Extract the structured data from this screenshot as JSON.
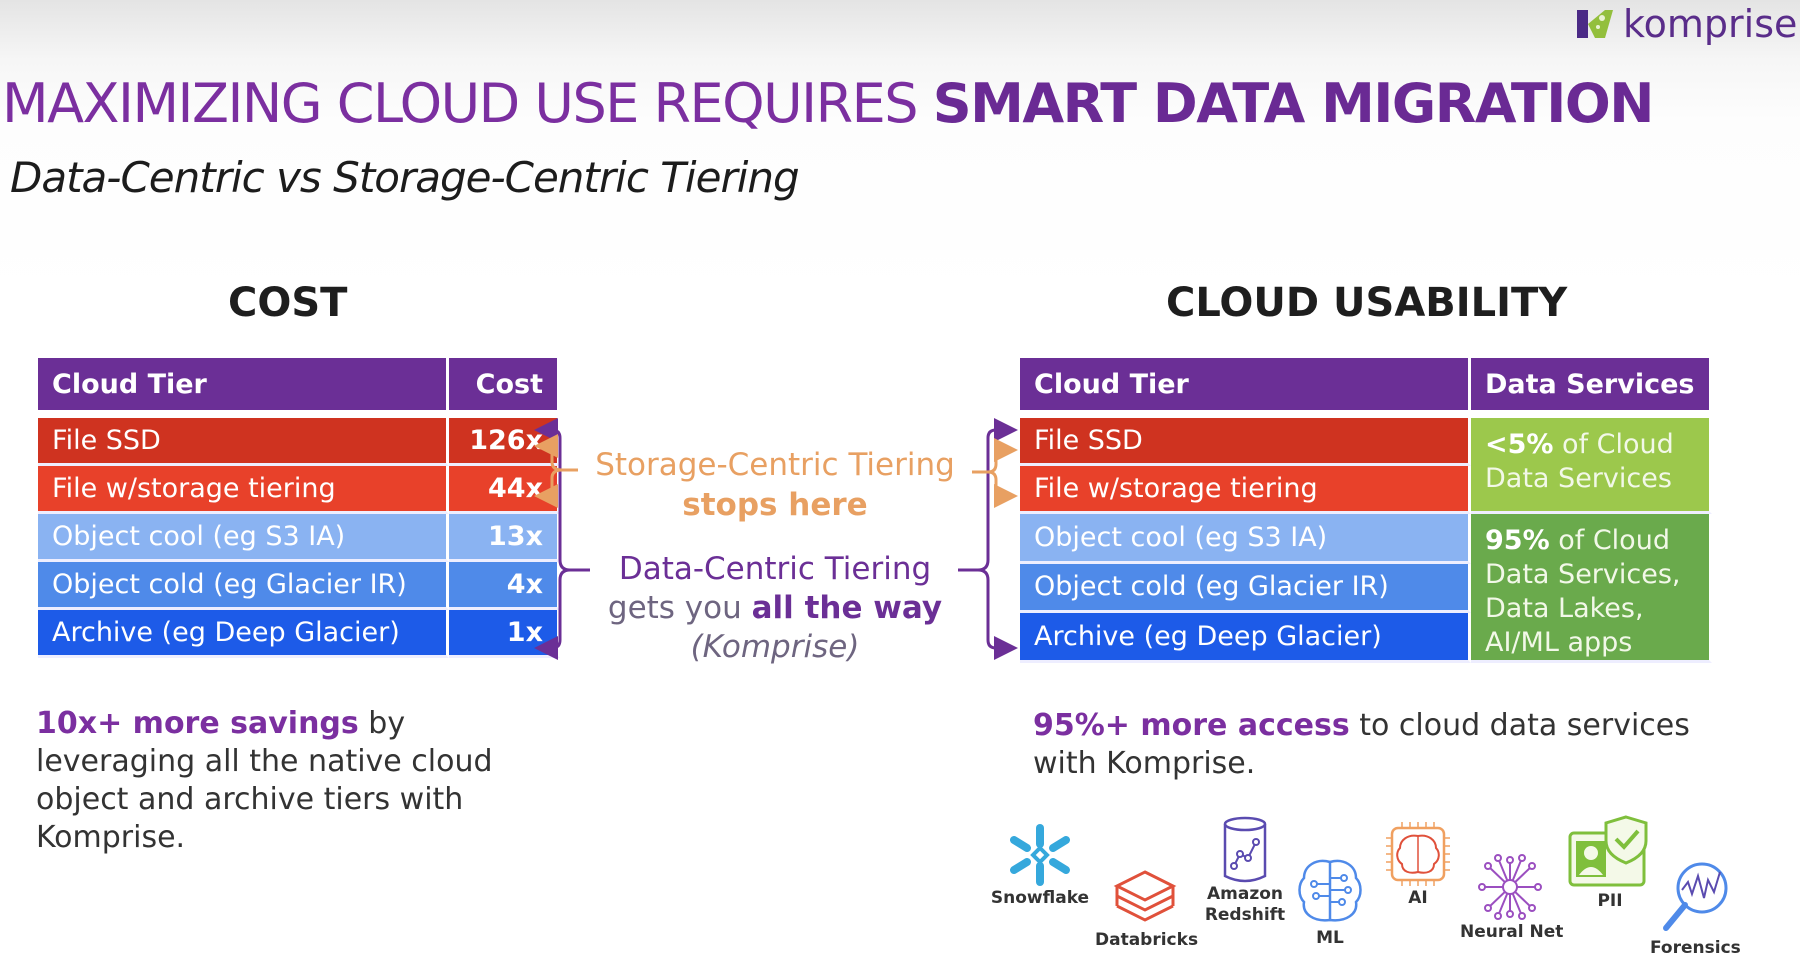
{
  "brand": {
    "name": "komprise"
  },
  "title": {
    "regular": "MAXIMIZING CLOUD USE REQUIRES ",
    "bold": "SMART DATA MIGRATION"
  },
  "subtitle": "Data-Centric vs Storage-Centric Tiering",
  "cost_section": {
    "heading": "COST",
    "columns": [
      "Cloud Tier",
      "Cost"
    ],
    "rows": [
      {
        "tier": "File SSD",
        "cost": "126x"
      },
      {
        "tier": "File w/storage tiering",
        "cost": "44x"
      },
      {
        "tier": "Object cool (eg S3 IA)",
        "cost": "13x"
      },
      {
        "tier": "Object cold (eg Glacier IR)",
        "cost": "4x"
      },
      {
        "tier": "Archive (eg Deep Glacier)",
        "cost": "1x"
      }
    ],
    "summary_bold": "10x+ more savings",
    "summary_rest": " by leveraging all the native cloud object and archive tiers with Komprise."
  },
  "usability_section": {
    "heading": "CLOUD USABILITY",
    "columns": [
      "Cloud Tier",
      "Data Services"
    ],
    "rows": [
      {
        "tier": "File SSD"
      },
      {
        "tier": "File w/storage tiering"
      },
      {
        "tier": "Object cool (eg S3 IA)"
      },
      {
        "tier": "Object cold (eg Glacier IR)"
      },
      {
        "tier": "Archive (eg Deep Glacier)"
      }
    ],
    "services": [
      {
        "bold": "<5%",
        "rest": " of Cloud Data Services"
      },
      {
        "bold": "95%",
        "rest": " of Cloud Data Services, Data Lakes, AI/ML apps"
      }
    ],
    "summary_bold": "95%+ more access",
    "summary_rest": " to cloud data services with Komprise."
  },
  "middle": {
    "storage_line1": "Storage-Centric Tiering",
    "storage_line2": "stops here",
    "data_line1": "Data-Centric Tiering",
    "data_line2_regular": "gets you ",
    "data_line2_bold": "all the way",
    "data_line3": "(Komprise)"
  },
  "colors": {
    "brand_purple": "#6b2f96",
    "storage_orange": "#e8a062",
    "file_ssd": "#cf3320",
    "file_tiering": "#e8412a",
    "object_cool": "#8ab3f2",
    "object_cold": "#4f8ae9",
    "archive": "#1d5be8",
    "services_low": "#9cc84c",
    "services_high": "#6aaa4c"
  },
  "services_icons": [
    {
      "icon": "snowflake-icon",
      "label": "Snowflake"
    },
    {
      "icon": "databricks-icon",
      "label": "Databricks"
    },
    {
      "icon": "redshift-icon",
      "label_line1": "Amazon",
      "label_line2": "Redshift"
    },
    {
      "icon": "ml-brain-icon",
      "label": "ML"
    },
    {
      "icon": "ai-chip-icon",
      "label": "AI"
    },
    {
      "icon": "neural-net-icon",
      "label": "Neural Net"
    },
    {
      "icon": "pii-id-icon",
      "label": "PII"
    },
    {
      "icon": "forensics-icon",
      "label": "Forensics"
    }
  ]
}
